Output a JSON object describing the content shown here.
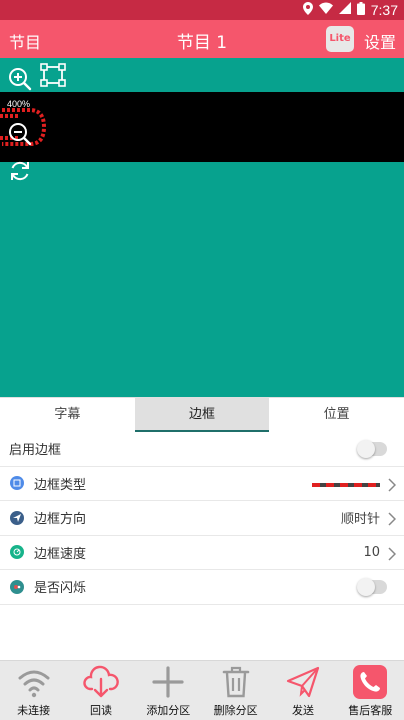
{
  "status_bar": {
    "time": "7:37",
    "icons": [
      "location-icon",
      "wifi-icon",
      "signal-icon",
      "battery-icon"
    ]
  },
  "app_bar": {
    "left_label": "节目",
    "title": "节目 1",
    "lite_badge": "Lite",
    "right_label": "设置"
  },
  "canvas": {
    "zoom_label": "400%",
    "tools": [
      "zoom-in-icon",
      "select-region-icon",
      "zoom-out-icon",
      "refresh-icon"
    ],
    "colors": {
      "background": "#07a28e",
      "screen": "#000000",
      "preview_text": "#e02020"
    }
  },
  "tabs": [
    {
      "label": "字幕",
      "active": false
    },
    {
      "label": "边框",
      "active": true
    },
    {
      "label": "位置",
      "active": false
    }
  ],
  "settings": {
    "enable_border": {
      "label": "启用边框",
      "on": false
    },
    "border_type": {
      "label": "边框类型"
    },
    "border_direction": {
      "label": "边框方向",
      "value": "顺时针"
    },
    "border_speed": {
      "label": "边框速度",
      "value": "10"
    },
    "blink": {
      "label": "是否闪烁",
      "on": false
    }
  },
  "bottom_bar": [
    {
      "label": "未连接",
      "icon": "wifi-icon"
    },
    {
      "label": "回读",
      "icon": "cloud-download-icon"
    },
    {
      "label": "添加分区",
      "icon": "plus-icon"
    },
    {
      "label": "删除分区",
      "icon": "trash-icon"
    },
    {
      "label": "发送",
      "icon": "send-icon"
    },
    {
      "label": "售后客服",
      "icon": "phone-icon"
    }
  ],
  "accent_colors": {
    "app_bar": "#f5566c",
    "status_bar": "#c62a44",
    "tab_indicator": "#1f6f6a"
  }
}
